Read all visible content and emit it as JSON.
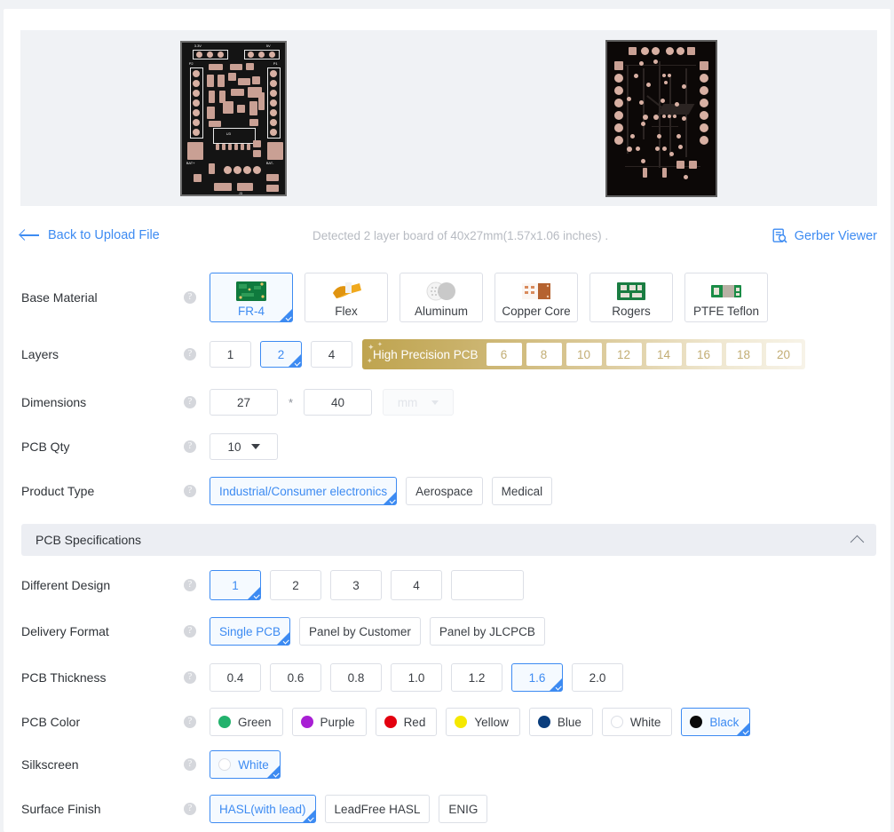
{
  "subheader": {
    "back_label": "Back to Upload File",
    "detected_text": "Detected 2 layer board of 40x27mm(1.57x1.06 inches) .",
    "gerber_label": "Gerber Viewer"
  },
  "rows": {
    "base_material": {
      "label": "Base Material",
      "options": [
        "FR-4",
        "Flex",
        "Aluminum",
        "Copper Core",
        "Rogers",
        "PTFE Teflon"
      ],
      "selected": "FR-4"
    },
    "layers": {
      "label": "Layers",
      "options": [
        "1",
        "2",
        "4"
      ],
      "selected": "2",
      "precision_label": "High Precision PCB",
      "precision_options": [
        "6",
        "8",
        "10",
        "12",
        "14",
        "16",
        "18",
        "20"
      ]
    },
    "dimensions": {
      "label": "Dimensions",
      "width_value": "27",
      "separator": "*",
      "length_value": "40",
      "unit_value": "mm"
    },
    "pcb_qty": {
      "label": "PCB Qty",
      "value": "10"
    },
    "product_type": {
      "label": "Product Type",
      "options": [
        "Industrial/Consumer electronics",
        "Aerospace",
        "Medical"
      ],
      "selected": "Industrial/Consumer electronics"
    },
    "section_title": "PCB Specifications",
    "different_design": {
      "label": "Different Design",
      "options": [
        "1",
        "2",
        "3",
        "4"
      ],
      "selected": "1",
      "custom_value": ""
    },
    "delivery_format": {
      "label": "Delivery Format",
      "options": [
        "Single PCB",
        "Panel by Customer",
        "Panel by JLCPCB"
      ],
      "selected": "Single PCB"
    },
    "pcb_thickness": {
      "label": "PCB Thickness",
      "options": [
        "0.4",
        "0.6",
        "0.8",
        "1.0",
        "1.2",
        "1.6",
        "2.0"
      ],
      "selected": "1.6"
    },
    "pcb_color": {
      "label": "PCB Color",
      "options": [
        {
          "name": "Green",
          "hex": "#23b26d"
        },
        {
          "name": "Purple",
          "hex": "#a81fd4"
        },
        {
          "name": "Red",
          "hex": "#e3000f"
        },
        {
          "name": "Yellow",
          "hex": "#f5e800"
        },
        {
          "name": "Blue",
          "hex": "#0a3d7c"
        },
        {
          "name": "White",
          "hex": "#ffffff"
        },
        {
          "name": "Black",
          "hex": "#0a0a0a"
        }
      ],
      "selected": "Black"
    },
    "silkscreen": {
      "label": "Silkscreen",
      "options": [
        {
          "name": "White",
          "hex": "#ffffff"
        }
      ],
      "selected": "White"
    },
    "surface_finish": {
      "label": "Surface Finish",
      "options": [
        "HASL(with lead)",
        "LeadFree HASL",
        "ENIG"
      ],
      "selected": "HASL(with lead)"
    }
  },
  "colors": {
    "accent": "#3d8bf2",
    "border": "#dcdfe6",
    "gold": "#bfa44f",
    "page_bg": "#f0f2f5"
  }
}
